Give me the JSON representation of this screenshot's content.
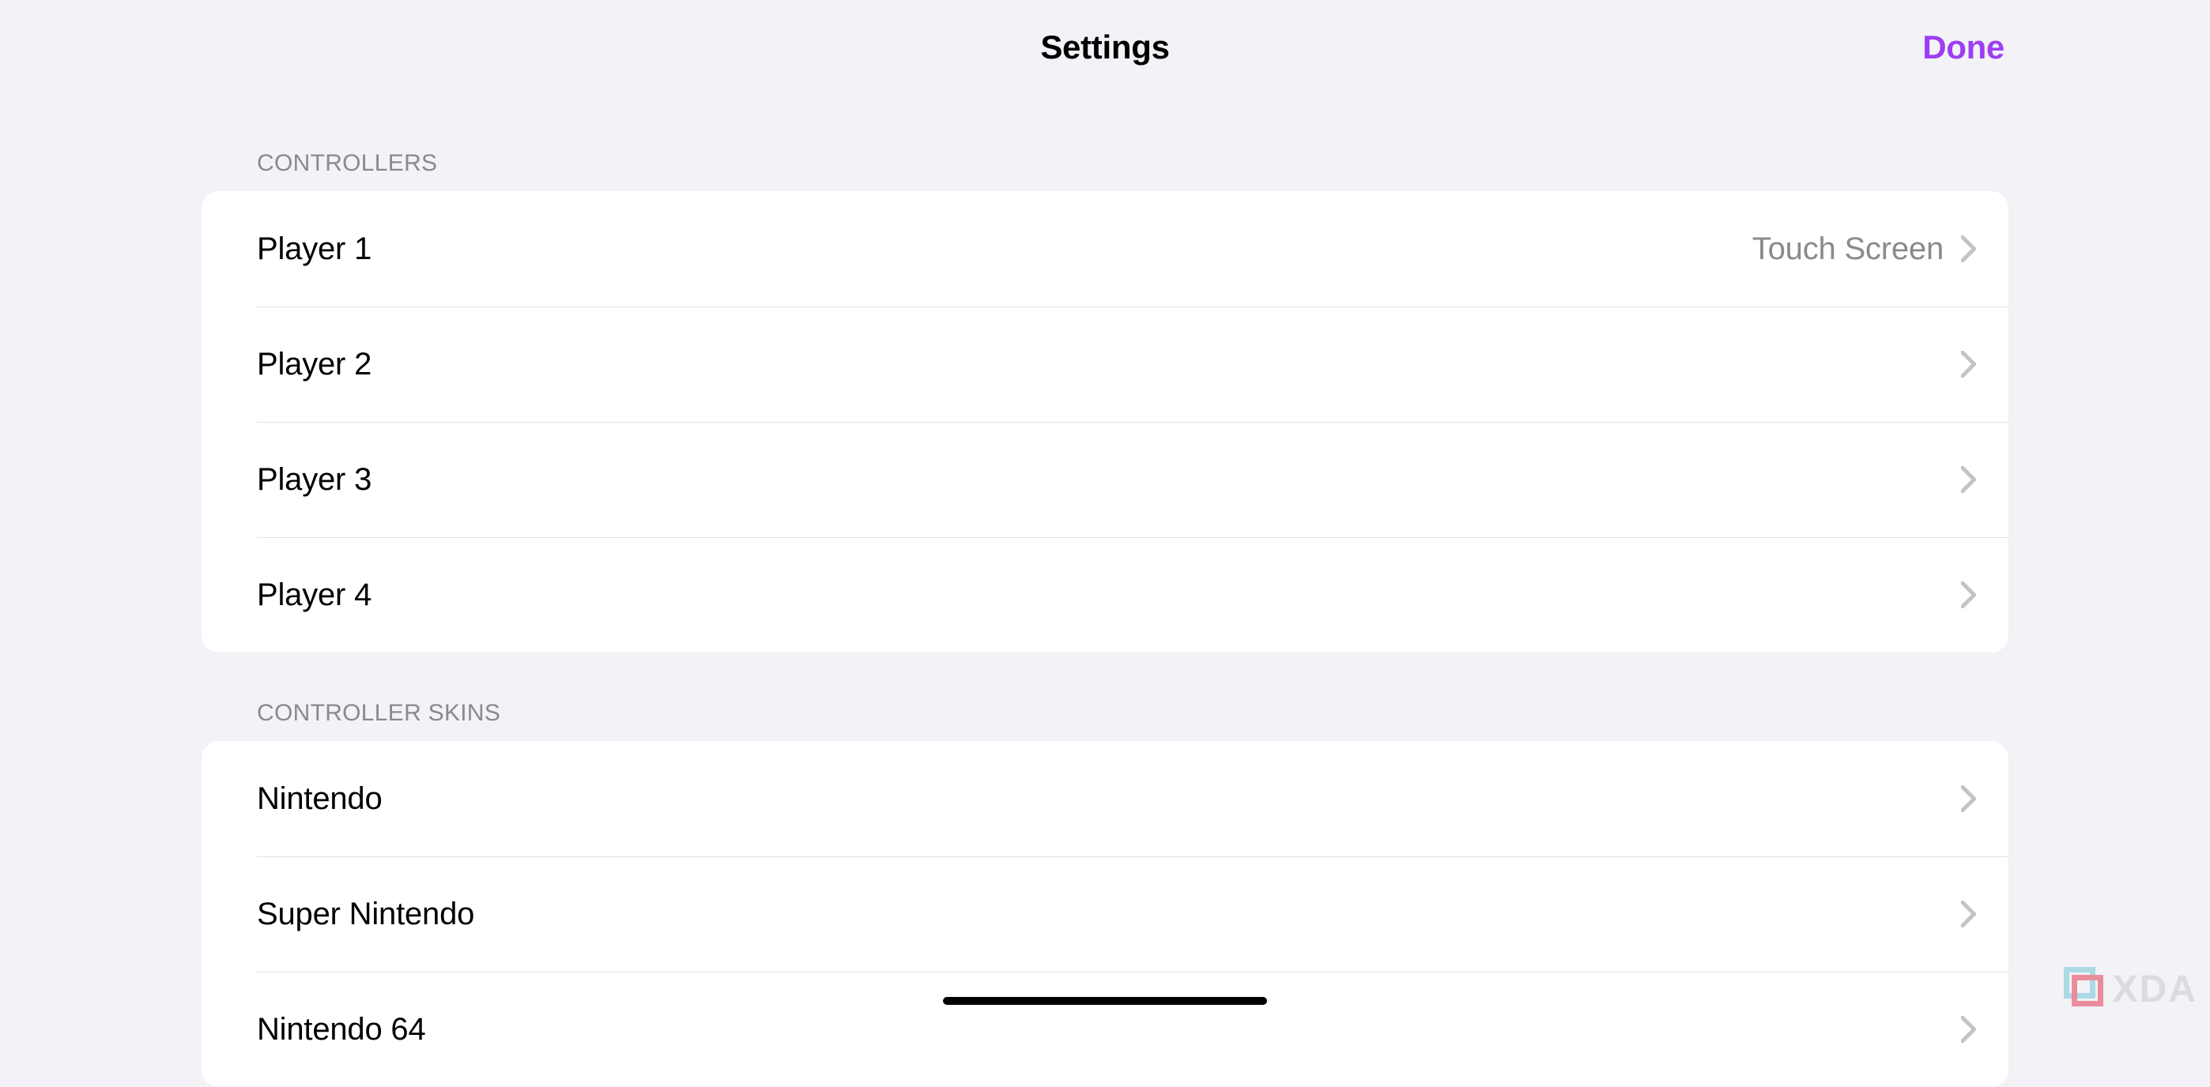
{
  "nav": {
    "title": "Settings",
    "done": "Done"
  },
  "sections": {
    "controllers": {
      "header": "CONTROLLERS",
      "rows": [
        {
          "label": "Player 1",
          "detail": "Touch Screen"
        },
        {
          "label": "Player 2",
          "detail": ""
        },
        {
          "label": "Player 3",
          "detail": ""
        },
        {
          "label": "Player 4",
          "detail": ""
        }
      ]
    },
    "skins": {
      "header": "CONTROLLER SKINS",
      "rows": [
        {
          "label": "Nintendo",
          "detail": ""
        },
        {
          "label": "Super Nintendo",
          "detail": ""
        },
        {
          "label": "Nintendo 64",
          "detail": ""
        }
      ]
    }
  },
  "watermark": "XDA"
}
